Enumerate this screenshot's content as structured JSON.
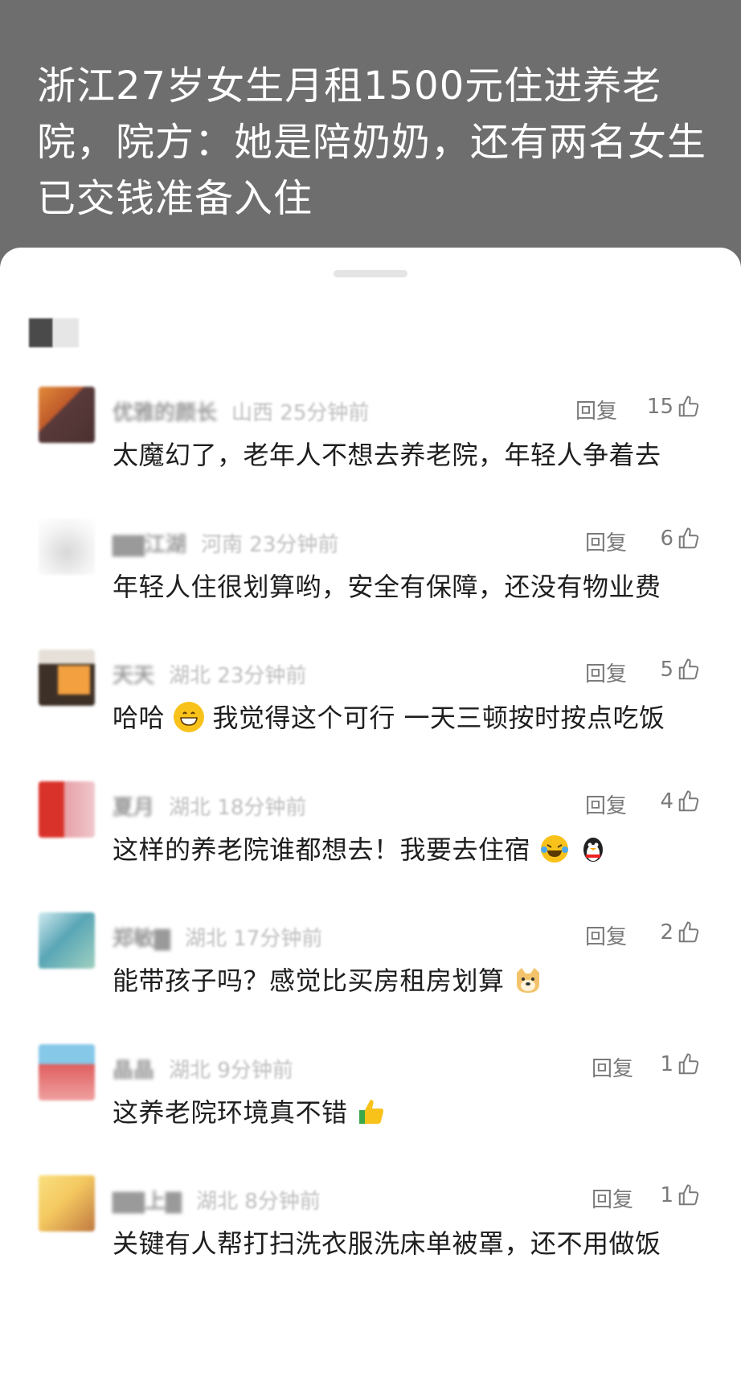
{
  "article": {
    "title": "浙江27岁女生月租1500元住进养老院，院方：她是陪奶奶，还有两名女生已交钱准备入住"
  },
  "comments": [
    {
      "name": "优雅的颜长",
      "location": "山西 25分钟前",
      "reply_label": "回复",
      "likes": "15",
      "text": "太魔幻了，老年人不想去养老院，年轻人争着去",
      "avatar_colors": [
        "#e08a3a",
        "#5a3a3a"
      ]
    },
    {
      "name": "▇▇江湖",
      "location": "河南 23分钟前",
      "reply_label": "回复",
      "likes": "6",
      "text": "年轻人住很划算哟，安全有保障，还没有物业费",
      "avatar_colors": [
        "#e8e8e8",
        "#cfcfcf"
      ]
    },
    {
      "name": "天天",
      "location": "湖北 23分钟前",
      "reply_label": "回复",
      "likes": "5",
      "text": "哈哈",
      "text_after_emoji": "我觉得这个可行 一天三顿按时按点吃饭",
      "emoji": "grinning-face-icon",
      "avatar_colors": [
        "#3d3026",
        "#f2a040"
      ]
    },
    {
      "name": "夏月",
      "location": "湖北 18分钟前",
      "reply_label": "回复",
      "likes": "4",
      "text": "这样的养老院谁都想去！我要去住宿",
      "emoji": "laughing-tears-icon",
      "emoji_2": "penguin-icon",
      "avatar_colors": [
        "#d9322a",
        "#e7a0a8"
      ]
    },
    {
      "name": "郑敏▇",
      "location": "湖北 17分钟前",
      "reply_label": "回复",
      "likes": "2",
      "text": "能带孩子吗？感觉比买房租房划算",
      "emoji": "doge-icon",
      "avatar_colors": [
        "#5aa6b6",
        "#9fd0c0"
      ]
    },
    {
      "name": "晶晶",
      "location": "湖北 9分钟前",
      "reply_label": "回复",
      "likes": "1",
      "text": "这养老院环境真不错",
      "emoji": "thumbs-up-icon",
      "avatar_colors": [
        "#e06060",
        "#86c8e8"
      ]
    },
    {
      "name": "▇▇上▇",
      "location": "湖北 8分钟前",
      "reply_label": "回复",
      "likes": "1",
      "text": "关键有人帮打扫洗衣服洗床单被罩，还不用做饭",
      "avatar_colors": [
        "#f4c860",
        "#c07a40"
      ]
    }
  ],
  "colors": {
    "text": "#1e1e1e",
    "muted": "#7a7a7a",
    "header_bg": "#6e6e6e"
  }
}
